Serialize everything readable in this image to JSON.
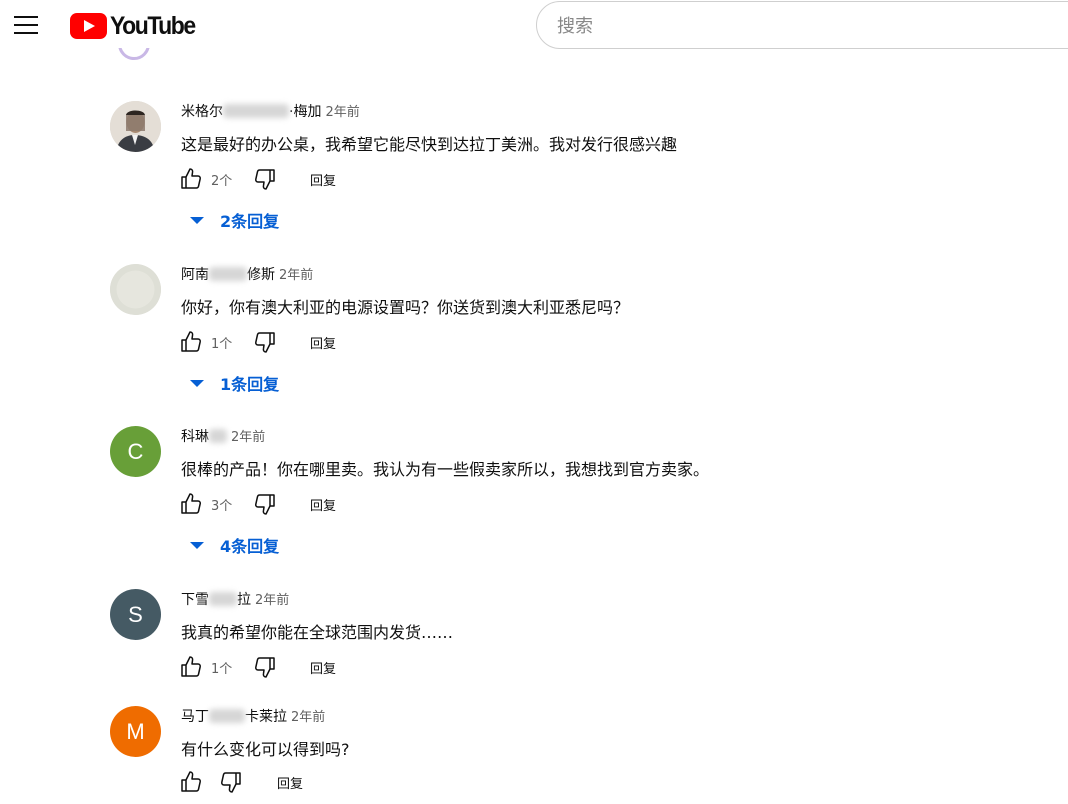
{
  "header": {
    "logo_text": "YouTube",
    "search_placeholder": "搜索"
  },
  "comments": [
    {
      "author_prefix": "米格尔",
      "author_suffix": "·梅加",
      "time": "2年前",
      "text": "这是最好的办公桌，我希望它能尽快到达拉丁美洲。我对发行很感兴趣",
      "likes": "2个",
      "reply_label": "回复",
      "replies_label": "2条回复",
      "avatar_color": "#9a8f83"
    },
    {
      "author_prefix": "阿南",
      "author_suffix": "修斯",
      "time": "2年前",
      "text": "你好，你有澳大利亚的电源设置吗？你送货到澳大利亚悉尼吗？",
      "likes": "1个",
      "reply_label": "回复",
      "replies_label": "1条回复",
      "avatar_color": "#dcdcd4"
    },
    {
      "avatar_letter": "C",
      "author_prefix": "科琳",
      "author_suffix": "",
      "time": "2年前",
      "text": "很棒的产品！你在哪里卖。我认为有一些假卖家所以，我想找到官方卖家。",
      "likes": "3个",
      "reply_label": "回复",
      "replies_label": "4条回复",
      "avatar_color": "#689f38"
    },
    {
      "avatar_letter": "S",
      "author_prefix": "下雪",
      "author_suffix": "拉",
      "time": "2年前",
      "text": "我真的希望你能在全球范围内发货……",
      "likes": "1个",
      "reply_label": "回复",
      "avatar_color": "#455a64"
    },
    {
      "avatar_letter": "M",
      "author_prefix": "马丁",
      "author_suffix": "卡莱拉",
      "time": "2年前",
      "text": "有什么变化可以得到吗?",
      "reply_label": "回复",
      "avatar_color": "#ef6c00"
    }
  ]
}
